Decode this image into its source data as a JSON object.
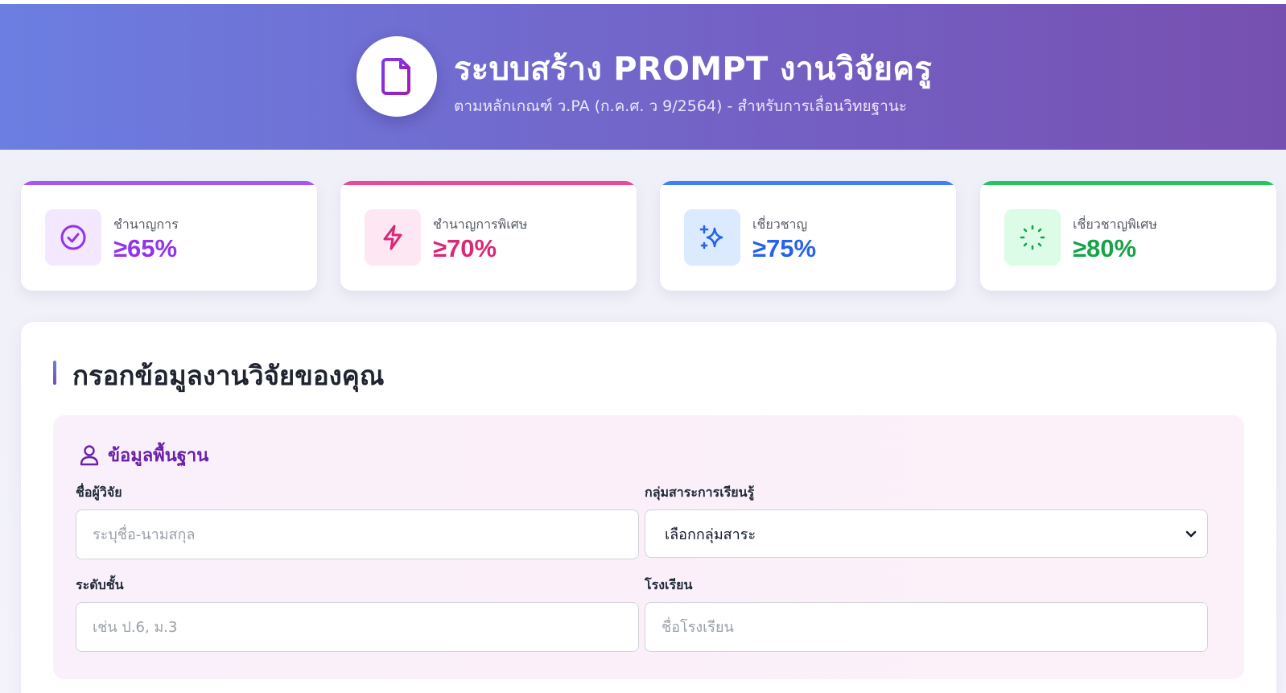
{
  "header": {
    "title": "ระบบสร้าง PROMPT งานวิจัยครู",
    "subtitle": "ตามหลักเกณฑ์ ว.PA (ก.ค.ศ. ว 9/2564) - สำหรับการเลื่อนวิทยฐานะ",
    "logo_icon": "document-icon"
  },
  "levels": [
    {
      "label": "ชำนาญการ",
      "value": "≥65%",
      "icon": "check-circle-icon",
      "color": "#9333ea",
      "bg": "#f3e8ff"
    },
    {
      "label": "ชำนาญการพิเศษ",
      "value": "≥70%",
      "icon": "lightning-icon",
      "color": "#db2777",
      "bg": "#fce7f3"
    },
    {
      "label": "เชี่ยวชาญ",
      "value": "≥75%",
      "icon": "sparkles-icon",
      "color": "#2563eb",
      "bg": "#dbeafe"
    },
    {
      "label": "เชี่ยวชาญพิเศษ",
      "value": "≥80%",
      "icon": "loader-icon",
      "color": "#16a34a",
      "bg": "#dcfce7"
    }
  ],
  "form": {
    "title": "กรอกข้อมูลงานวิจัยของคุณ",
    "section_title": "ข้อมูลพื้นฐาน",
    "section_icon": "user-icon",
    "researcher": {
      "label": "ชื่อผู้วิจัย",
      "placeholder": "ระบุชื่อ-นามสกุล",
      "value": ""
    },
    "subject": {
      "label": "กลุ่มสาระการเรียนรู้",
      "selected": "เลือกกลุ่มสาระ"
    },
    "grade": {
      "label": "ระดับชั้น",
      "placeholder": "เช่น ป.6, ม.3",
      "value": ""
    },
    "school": {
      "label": "โรงเรียน",
      "placeholder": "ชื่อโรงเรียน",
      "value": ""
    }
  }
}
